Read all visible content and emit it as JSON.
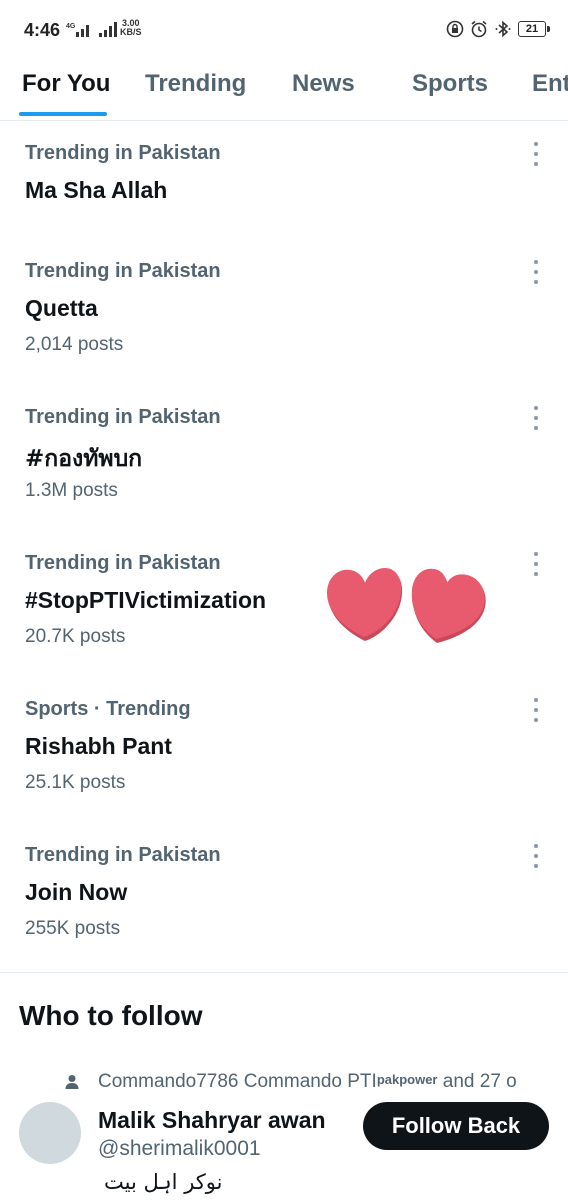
{
  "status_bar": {
    "time": "4:46",
    "network_speed": "3.00",
    "network_speed_unit": "KB/S",
    "battery_level": "21"
  },
  "tabs": [
    {
      "label": "For You",
      "active": true
    },
    {
      "label": "Trending",
      "active": false
    },
    {
      "label": "News",
      "active": false
    },
    {
      "label": "Sports",
      "active": false
    },
    {
      "label": "Ent",
      "active": false
    }
  ],
  "trends": [
    {
      "context": "Trending in Pakistan",
      "title": "Ma Sha Allah",
      "count": ""
    },
    {
      "context": "Trending in Pakistan",
      "title": "Quetta",
      "count": "2,014 posts"
    },
    {
      "context": "Trending in Pakistan",
      "title": "#กองทัพบก",
      "count": "1.3M posts"
    },
    {
      "context": "Trending in Pakistan",
      "title": "#StopPTIVictimization",
      "count": "20.7K posts"
    },
    {
      "context": "Sports · Trending",
      "title": "Rishabh Pant",
      "count": "25.1K posts"
    },
    {
      "context": "Trending in Pakistan",
      "title": "Join Now",
      "count": "255K posts"
    }
  ],
  "who_to_follow": {
    "heading": "Who to follow",
    "social_context": "Commando7786 Commando PTI",
    "social_context_sup": "pakpower",
    "social_context_tail": " and 27 o",
    "user": {
      "name": "Malik Shahryar awan",
      "handle": "@sherimalik0001",
      "bio": "نوکر اہل بیت",
      "follow_label": "Follow Back"
    }
  },
  "colors": {
    "accent": "#1d9bf0",
    "secondary_text": "#536471",
    "heart": "#e85a6e"
  }
}
